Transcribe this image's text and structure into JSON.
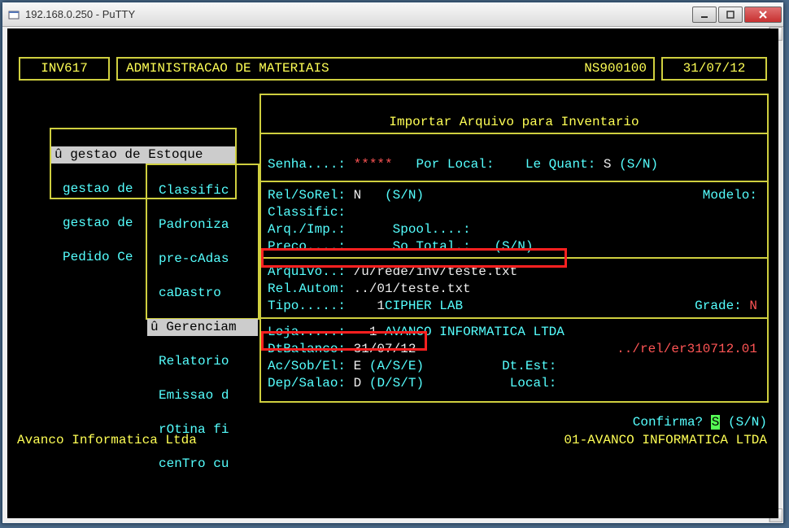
{
  "window": {
    "title": "192.168.0.250 - PuTTY"
  },
  "header": {
    "code": "INV617",
    "title": "ADMINISTRACAO DE MATERIAIS",
    "session": "NS900100",
    "date": "31/07/12"
  },
  "menu1": {
    "selected": "û gestao de Estoque",
    "items": [
      "gestao de",
      "gestao de",
      "Pedido Ce"
    ]
  },
  "menu2": {
    "items": [
      "Classific",
      "Padroniza",
      "pre-cAdas",
      "caDastro"
    ],
    "selected": "û Gerenciam",
    "items2": [
      "Relatorio",
      "Emissao d",
      "rOtina fi",
      "cenTro cu"
    ]
  },
  "panel": {
    "title": "Importar Arquivo para Inventario",
    "rows": {
      "senha_label": "Senha....:",
      "senha_value": "*****",
      "por_local_label": "Por Local:",
      "le_quant_label": "Le Quant:",
      "le_quant_value": "S",
      "le_quant_hint": "(S/N)",
      "rel_sorel_label": "Rel/SoRel:",
      "rel_sorel_value": "N",
      "rel_sorel_hint": "(S/N)",
      "modelo_label": "Modelo:",
      "classific_label": "Classific:",
      "arq_imp_label": "Arq./Imp.:",
      "spool_label": "Spool....:",
      "preco_label": "Preco....:",
      "so_total_label": "So Total.:",
      "so_total_hint": "(S/N)",
      "arquivo_label": "Arquivo..:",
      "arquivo_value": "/u/rede/inv/teste.txt",
      "rel_autom_label": "Rel.Autom:",
      "rel_autom_value": "../01/teste.txt",
      "tipo_label": "Tipo.....:",
      "tipo_value": "1",
      "tipo_name": "CIPHER LAB",
      "grade_label": "Grade:",
      "grade_value": "N",
      "loja_label": "Loja.....:",
      "loja_value": "1",
      "loja_name": "AVANCO INFORMATICA LTDA",
      "dtbalanco_label": "DtBalanco:",
      "dtbalanco_value": "31/07/12",
      "err_file": "../rel/er310712.01",
      "acsobel_label": "Ac/Sob/El:",
      "acsobel_value": "E",
      "acsobel_hint": "(A/S/E)",
      "dtest_label": "Dt.Est:",
      "depsalao_label": "Dep/Salao:",
      "depsalao_value": "D",
      "depsalao_hint": "(D/S/T)",
      "local_label": "Local:"
    }
  },
  "footer": {
    "confirm_label": "Confirma?",
    "confirm_value": "S",
    "confirm_hint": "(S/N)",
    "left": "Avanco Informatica Ltda",
    "right": "01-AVANCO INFORMATICA LTDA"
  }
}
